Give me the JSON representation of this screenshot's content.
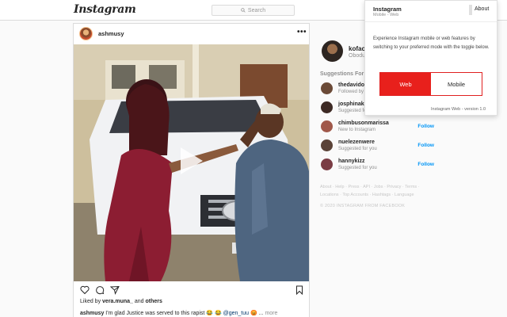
{
  "topbar": {
    "logo": "Instagram",
    "search_placeholder": "Search"
  },
  "post": {
    "username": "ashmusy",
    "more_label": "•••",
    "liked_prefix": "Liked by ",
    "liked_user": "vera.muna_",
    "liked_and": " and ",
    "liked_others": "others",
    "caption_user": "ashmusy",
    "caption_text": " I'm glad Justice was served to this rapist 😂 😂  ",
    "caption_mention": "@gen_tuu",
    "caption_tail": " 😡 ... ",
    "caption_more": "more",
    "icons": [
      "heart-icon",
      "comment-icon",
      "share-icon",
      "bookmark-icon",
      "play-icon"
    ]
  },
  "sidebar": {
    "me_name": "kofac",
    "me_sub": "Obodu",
    "suggestions_title": "Suggestions For",
    "suggestions": [
      {
        "name": "thedavido",
        "sub": "Followed by",
        "follow": ""
      },
      {
        "name": "josphinak",
        "sub": "Suggested fo",
        "follow": ""
      },
      {
        "name": "chimbusonmarissa",
        "sub": "New to Instagram",
        "follow": "Follow"
      },
      {
        "name": "nuelezenwere",
        "sub": "Suggested for you",
        "follow": "Follow"
      },
      {
        "name": "hannykizz",
        "sub": "Suggested for you",
        "follow": "Follow"
      }
    ],
    "footer_links": "About · Help · Press · API · Jobs · Privacy · Terms · Locations · Top Accounts · Hashtags · Language",
    "copyright": "© 2020 INSTAGRAM FROM FACEBOOK"
  },
  "popup": {
    "title": "Instagram",
    "subtitle": "Mobile - Web",
    "about": "About",
    "description": "Experience Instagram mobile or web features by switching to your preferred mode with the toggle below.",
    "toggle_web": "Web",
    "toggle_mobile": "Mobile",
    "footer": "Instagram Web - version 1.0",
    "accent": "#e8201c"
  }
}
